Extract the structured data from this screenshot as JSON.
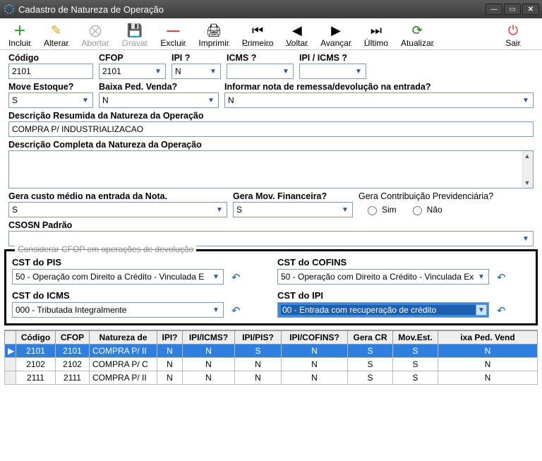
{
  "window": {
    "title": "Cadastro de Natureza de Operação"
  },
  "toolbar": {
    "incluir": "Incluir",
    "alterar": "Alterar",
    "abortar": "Abortar",
    "gravar": "Gravar",
    "excluir": "Excluir",
    "imprimir": "Imprimir",
    "primeiro": "Primeiro",
    "voltar": "Voltar",
    "avancar": "Avançar",
    "ultimo": "Último",
    "atualizar": "Atualizar",
    "sair": "Sair"
  },
  "labels": {
    "codigo": "Código",
    "cfop": "CFOP",
    "ipi": "IPI ?",
    "icms": "ICMS ?",
    "ipi_icms": "IPI / ICMS ?",
    "move_estoque": "Move Estoque?",
    "baixa_ped": "Baixa Ped. Venda?",
    "informar_nota": "Informar nota de remessa/devolução na entrada?",
    "desc_resumida": "Descrição Resumida da Natureza da Operação",
    "desc_completa": "Descrição Completa da Natureza da Operação",
    "gera_custo": "Gera custo médio na entrada da Nota.",
    "gera_mov": "Gera Mov. Financeira?",
    "gera_contrib": "Gera Contribuição Previdenciária?",
    "sim": "Sim",
    "nao": "Não",
    "csosn": "CSOSN Padrão",
    "considerar": "Considerar CFOP em operações de devolução",
    "cst_pis": "CST do PIS",
    "cst_cofins": "CST do COFINS",
    "cst_icms": "CST do ICMS",
    "cst_ipi": "CST do IPI"
  },
  "values": {
    "codigo": "2101",
    "cfop": "2101",
    "ipi": "N",
    "icms": "",
    "ipi_icms": "",
    "move_estoque": "S",
    "baixa_ped": "N",
    "informar_nota": "N",
    "desc_resumida": "COMPRA P/ INDUSTRIALIZACAO",
    "desc_completa": "",
    "gera_custo": "S",
    "gera_mov": "S",
    "csosn": "",
    "cst_pis": "50 - Operação com Direito a Crédito - Vinculada E",
    "cst_cofins": "50 - Operação com Direito a Crédito - Vinculada Ex",
    "cst_icms": "000 - Tributada Integralmente",
    "cst_ipi": "00 - Entrada com recuperação de crédito"
  },
  "grid": {
    "headers": [
      "Código",
      "CFOP",
      "Natureza de",
      "IPI?",
      "IPI/ICMS?",
      "IPI/PIS?",
      "IPI/COFINS?",
      "Gera CR",
      "Mov.Est.",
      "ixa Ped. Vend"
    ],
    "rows": [
      {
        "sel": true,
        "cells": [
          "2101",
          "2101",
          "COMPRA P/ II",
          "N",
          "N",
          "S",
          "N",
          "S",
          "S",
          "N"
        ]
      },
      {
        "sel": false,
        "cells": [
          "2102",
          "2102",
          "COMPRA P/ C",
          "N",
          "N",
          "N",
          "N",
          "S",
          "S",
          "N"
        ]
      },
      {
        "sel": false,
        "cells": [
          "2111",
          "2111",
          "COMPRA P/ II",
          "N",
          "N",
          "N",
          "N",
          "S",
          "S",
          "N"
        ]
      }
    ]
  },
  "chart_data": null
}
